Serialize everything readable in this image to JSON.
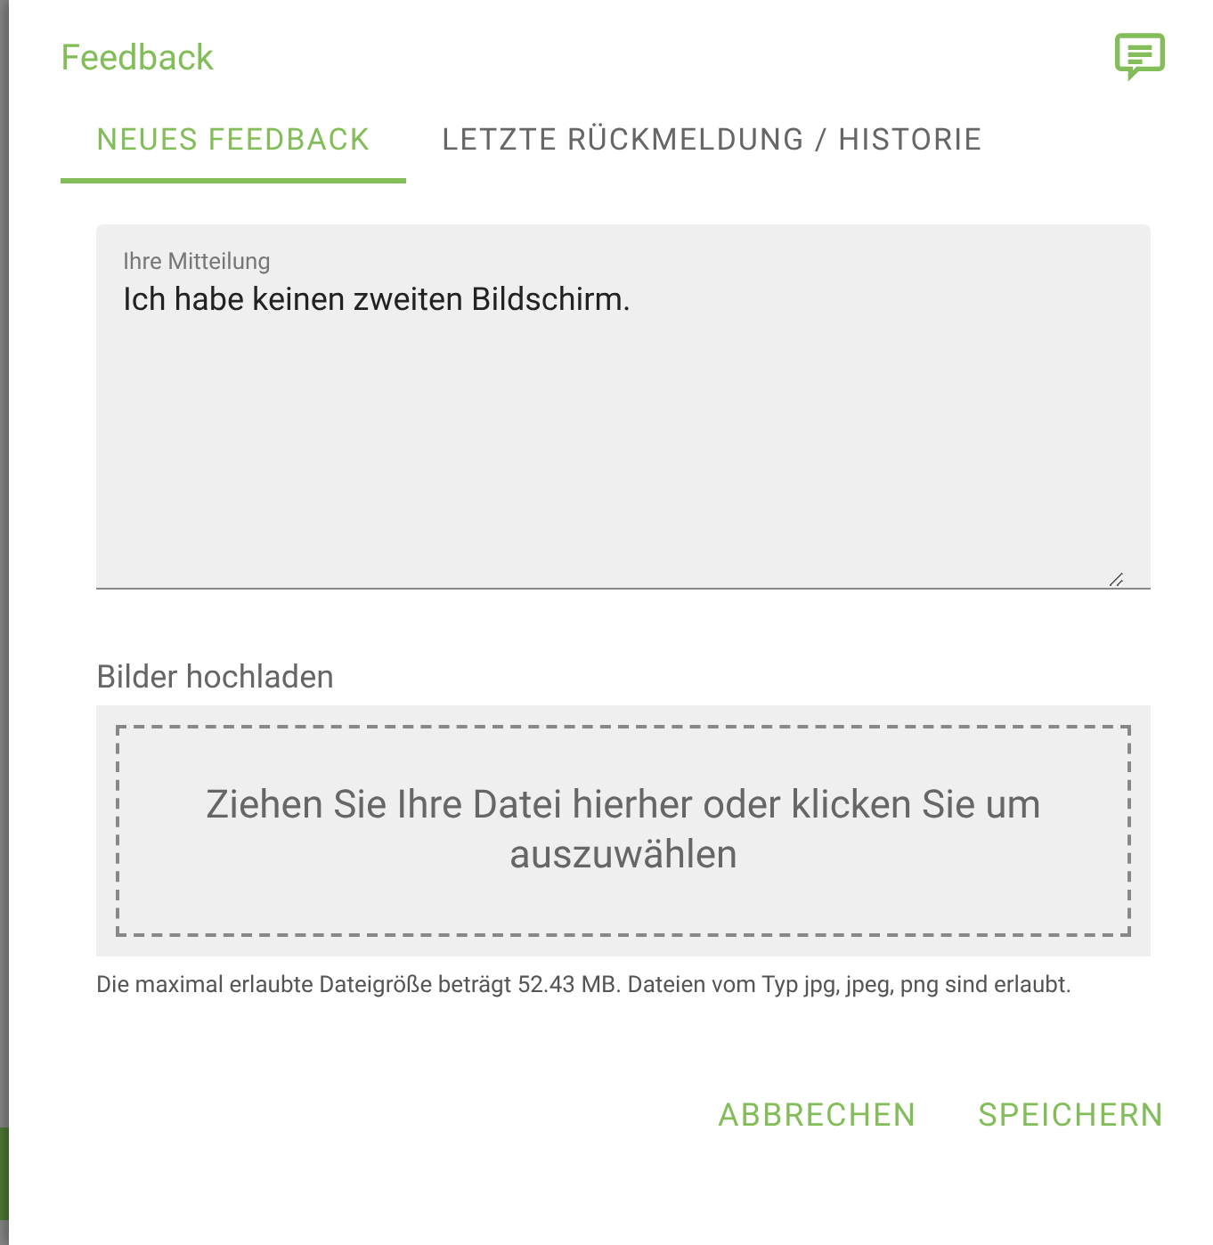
{
  "dialog": {
    "title": "Feedback"
  },
  "tabs": [
    {
      "label": "NEUES FEEDBACK",
      "selected": true
    },
    {
      "label": "LETZTE RÜCKMELDUNG / HISTORIE",
      "selected": false
    }
  ],
  "message": {
    "label": "Ihre Mitteilung",
    "value": "Ich habe keinen zweiten Bildschirm."
  },
  "upload": {
    "label": "Bilder hochladen",
    "dropzone_text": "Ziehen Sie Ihre Datei hierher oder klicken Sie um auszuwählen",
    "hint": "Die maximal erlaubte Dateigröße beträgt 52.43 MB. Dateien vom Typ jpg, jpeg, png sind erlaubt."
  },
  "buttons": [
    "ABBRECHEN",
    "SPEICHERN"
  ]
}
